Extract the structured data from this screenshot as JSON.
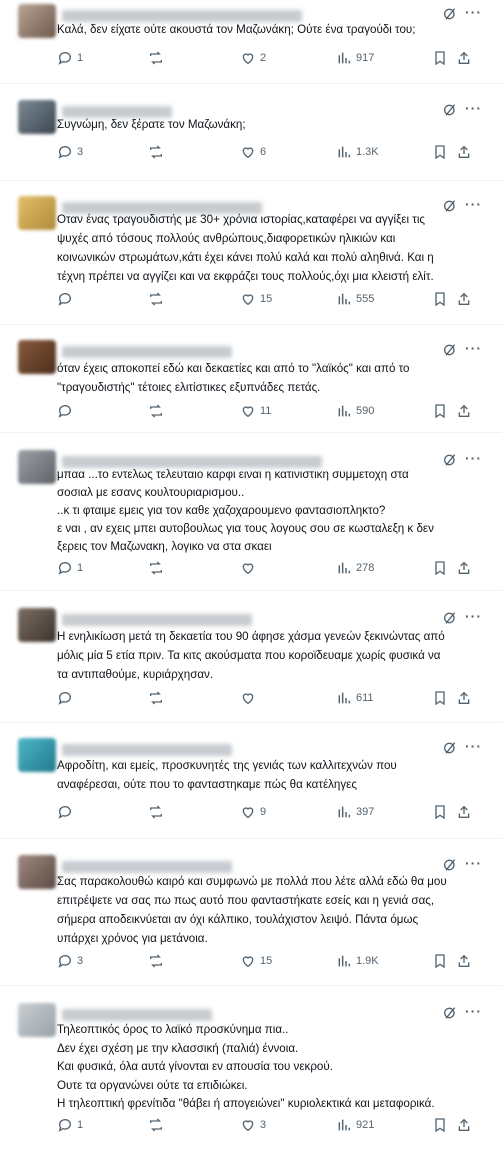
{
  "replies": [
    {
      "text": [
        "Καλά, δεν είχατε ούτε ακουστά τον Μαζωνάκη; Ούτε ένα τραγούδι του;"
      ],
      "replies": "1",
      "reposts": "",
      "likes": "2",
      "views": "917"
    },
    {
      "text": [
        "Συγνώμη, δεν ξέρατε τον Μαζωνάκη;"
      ],
      "replies": "3",
      "reposts": "",
      "likes": "6",
      "views": "1.3K"
    },
    {
      "text": [
        "Οταν ένας τραγουδιστής με 30+ χρόνια ιστορίας,καταφέρει να αγγίξει τις",
        "ψυχές από τόσους πολλούς ανθρώπους,διαφορετικών ηλικιών και",
        "κοινωνικών στρωμάτων,κάτι έχει κάνει πολύ καλά και πολύ αληθινά. Και η",
        "τέχνη πρέπει να αγγίζει και να εκφράζει τους πολλούς,όχι μια κλειστή ελίτ."
      ],
      "replies": "",
      "reposts": "",
      "likes": "15",
      "views": "555"
    },
    {
      "text": [
        "όταν έχεις αποκοπεί εδώ και δεκαετίες και από το \"λαϊκός\" και από το",
        "\"τραγουδιστής\" τέτοιες ελιτίστικες εξυπνάδες πετάς."
      ],
      "replies": "",
      "reposts": "",
      "likes": "11",
      "views": "590"
    },
    {
      "text": [
        "μπαα ...το εντελως τελευταιο καρφι ειναι η κατινιστικη συμμετοχη στα",
        "σοσιαλ με εσανς κουλτουριαρισμου..",
        "..κ τι φταιμε εμεις για τον καθε χαζοχαρουμενο φαντασιοπληκτο?",
        "ε ναι , αν εχεις μπει αυτοβουλως για τους λογους σου σε κωσταλεξη κ δεν",
        "ξερεις τον Μαζωνακη, λογικο να στα σκαει"
      ],
      "replies": "1",
      "reposts": "",
      "likes": "",
      "views": "278"
    },
    {
      "text": [
        "Η ενηλικίωση μετά τη δεκαετία του 90 άφησε χάσμα γενεών ξεκινώντας από",
        "μόλις μία 5 ετία πριν. Τα κιτς ακούσματα που κοροϊδευαμε χωρίς φυσικά να",
        "τα αντιπαθούμε, κυριάρχησαν."
      ],
      "replies": "",
      "reposts": "",
      "likes": "",
      "views": "611"
    },
    {
      "text": [
        "Αφροδίτη, και εμείς, προσκυνητές της γενιάς των καλλιτεχνών που",
        "αναφέρεσαι,  ούτε που το φανταστηκαμε πώς θα κατέληγες"
      ],
      "replies": "",
      "reposts": "",
      "likes": "9",
      "views": "397"
    },
    {
      "text": [
        "Σας παρακολουθώ καιρό και συμφωνώ με πολλά που λέτε αλλά εδώ θα μου",
        "επιτρέψετε να σας πω πως αυτό που φανταστήκατε εσείς και η γενιά σας,",
        "σήμερα αποδεικνύεται αν όχι κάλπικο, τουλάχιστον λειψό. Πάντα όμως",
        "υπάρχει χρόνος για μετάνοια."
      ],
      "replies": "3",
      "reposts": "",
      "likes": "15",
      "views": "1.9K"
    },
    {
      "text": [
        "Τηλεοπτικός όρος το λαϊκό προσκύνημα πια..",
        "Δεν έχει σχέση με την κλασσική (παλιά) έννοια.",
        "Και φυσικά, όλα αυτά γίνονται εν απουσία του νεκρού.",
        "Ουτε τα οργανώνει ούτε τα επιδιώκει.",
        "Η τηλεοπτική φρενίτιδα \"θάβει ή απογειώνει\" κυριολεκτικά και μεταφορικά."
      ],
      "replies": "1",
      "reposts": "",
      "likes": "3",
      "views": "921"
    }
  ],
  "more_label": "···",
  "colors": {
    "text": "#0f1419",
    "muted": "#536471",
    "divider": "#eff3f4"
  }
}
